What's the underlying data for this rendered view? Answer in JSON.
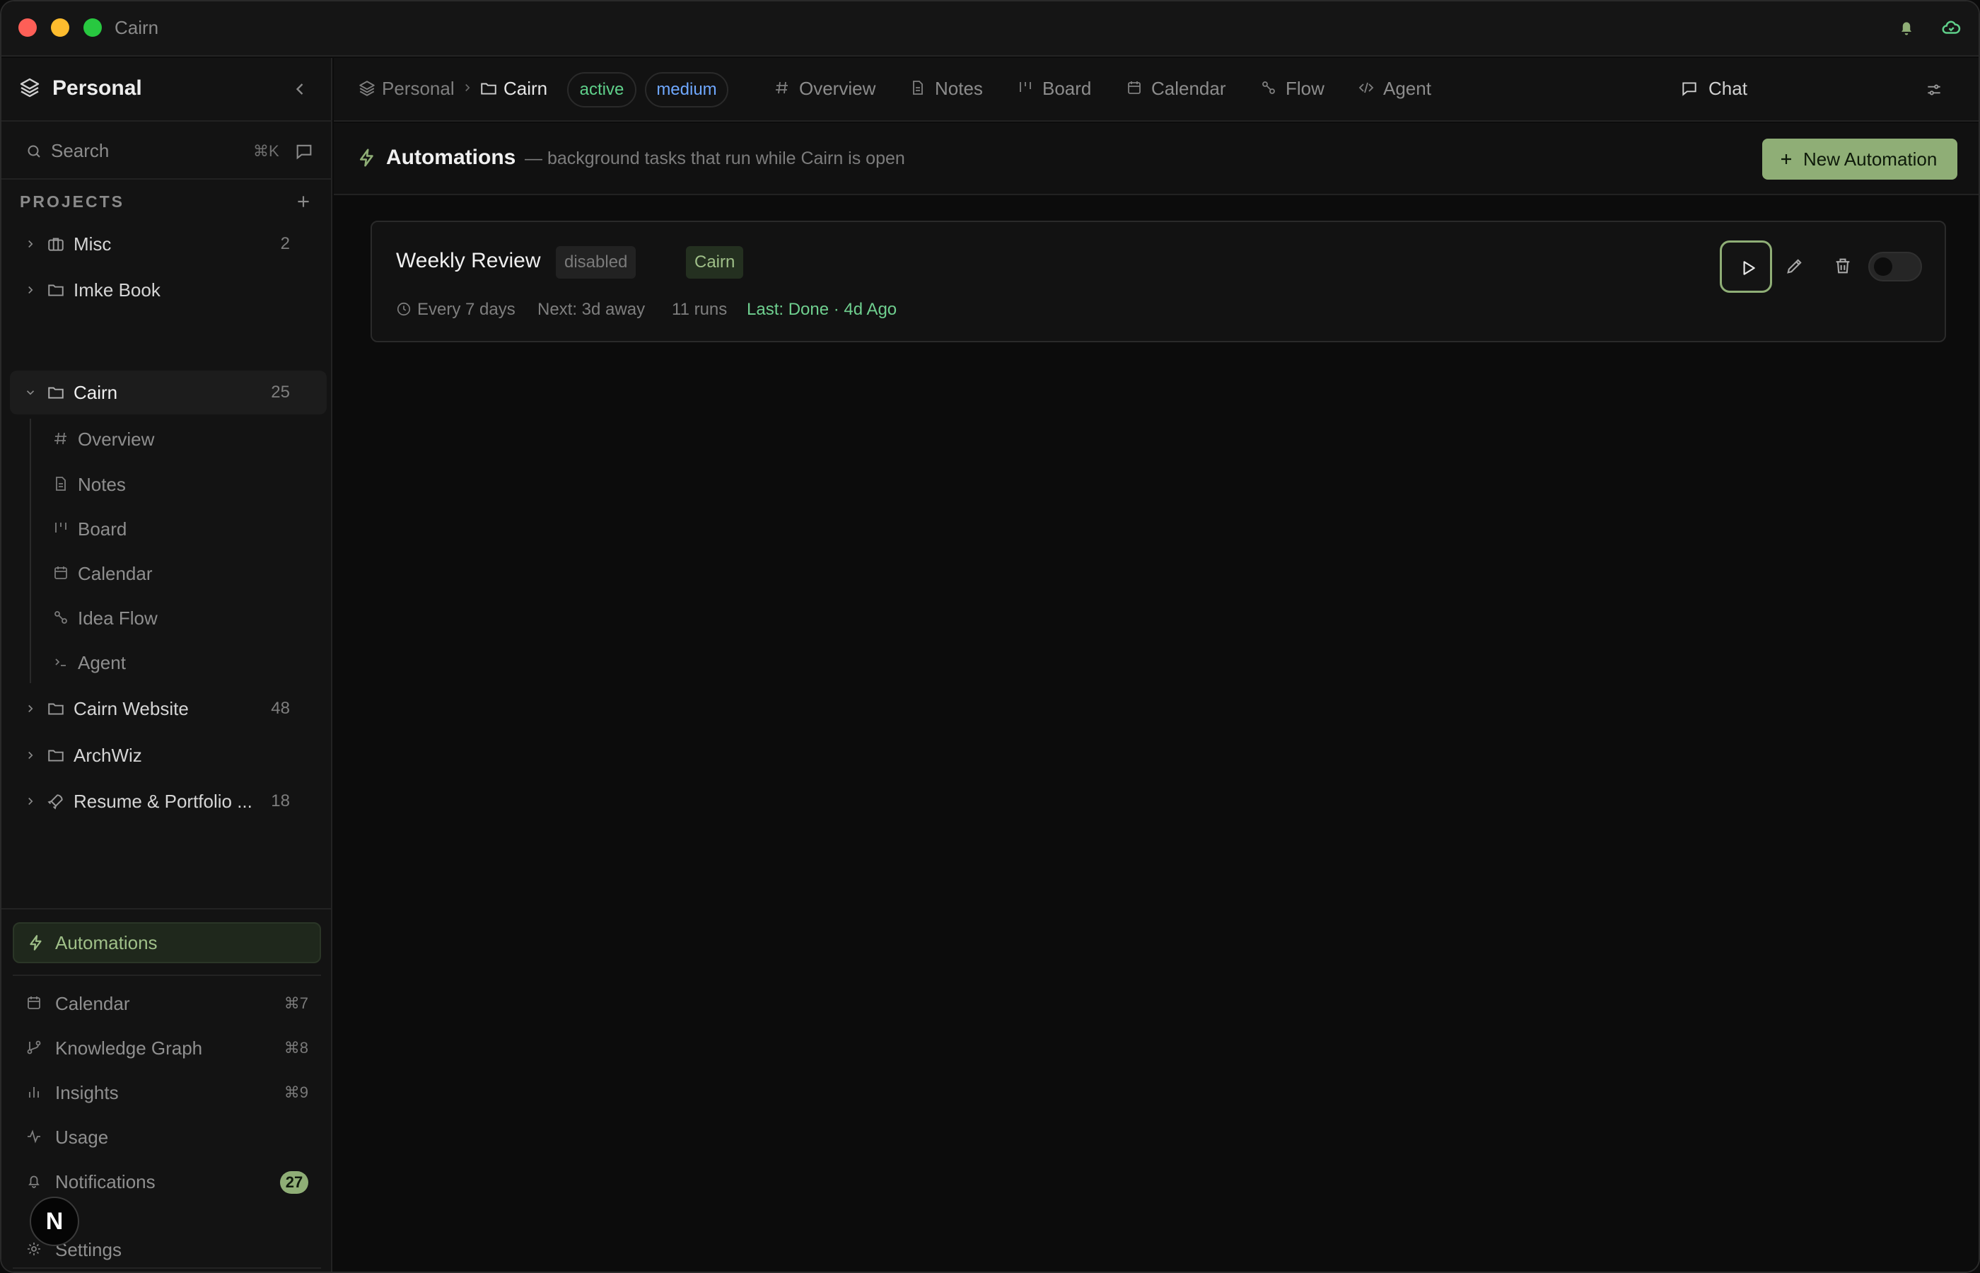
{
  "window": {
    "title": "Cairn"
  },
  "sidebar": {
    "workspace": "Personal",
    "search": {
      "label": "Search",
      "shortcut": "⌘K"
    },
    "projects_header": "PROJECTS",
    "projects": [
      {
        "name": "Misc",
        "count": "2",
        "icon": "briefcase-icon",
        "expanded": false
      },
      {
        "name": "Imke Book",
        "count": "",
        "icon": "folder-icon",
        "expanded": false
      },
      {
        "name": "Cairn",
        "count": "25",
        "icon": "folder-icon",
        "expanded": true
      },
      {
        "name": "Cairn Website",
        "count": "48",
        "icon": "folder-icon",
        "expanded": false
      },
      {
        "name": "ArchWiz",
        "count": "",
        "icon": "folder-icon",
        "expanded": false
      },
      {
        "name": "Resume & Portfolio ...",
        "count": "18",
        "icon": "rocket-icon",
        "expanded": false
      }
    ],
    "cairn_children": [
      {
        "label": "Overview",
        "icon": "hash-icon"
      },
      {
        "label": "Notes",
        "icon": "file-icon"
      },
      {
        "label": "Board",
        "icon": "kanban-icon"
      },
      {
        "label": "Calendar",
        "icon": "calendar-icon"
      },
      {
        "label": "Idea Flow",
        "icon": "flow-icon"
      },
      {
        "label": "Agent",
        "icon": "terminal-icon"
      }
    ],
    "bottom": {
      "automations": "Automations",
      "items": [
        {
          "label": "Calendar",
          "shortcut": "⌘7",
          "icon": "calendar-icon"
        },
        {
          "label": "Knowledge Graph",
          "shortcut": "⌘8",
          "icon": "git-branch-icon"
        },
        {
          "label": "Insights",
          "shortcut": "⌘9",
          "icon": "bar-chart-icon"
        },
        {
          "label": "Usage",
          "shortcut": "",
          "icon": "activity-icon"
        },
        {
          "label": "Notifications",
          "badge": "27",
          "icon": "bell-icon"
        }
      ],
      "settings": "Settings",
      "avatar": "N"
    }
  },
  "topnav": {
    "breadcrumb": [
      "Personal",
      "Cairn"
    ],
    "status_pill": "active",
    "priority_pill": "medium",
    "tabs": [
      "Overview",
      "Notes",
      "Board",
      "Calendar",
      "Flow",
      "Agent"
    ],
    "chat": "Chat"
  },
  "automations": {
    "title": "Automations",
    "description": "— background tasks that run while Cairn is open",
    "new_button": "New Automation",
    "items": [
      {
        "name": "Weekly Review",
        "status_tag": "disabled",
        "project_tag": "Cairn",
        "schedule": "Every 7 days",
        "next": "Next: 3d away",
        "runs": "11 runs",
        "last": "Last: Done · 4d Ago",
        "enabled": false
      }
    ]
  },
  "colors": {
    "accent": "#8fae76",
    "active_green": "#5fd08a",
    "medium_blue": "#6fa8ff",
    "last_done": "#6fcf8f",
    "background": "#0c0c0c"
  }
}
